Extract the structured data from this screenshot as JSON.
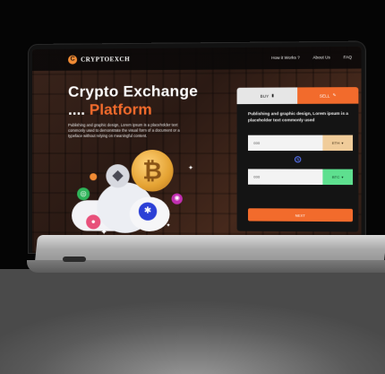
{
  "nav": {
    "logo_mark": "C",
    "brand": "CRYPTOEXCH",
    "links": [
      "How it Works ?",
      "About Us",
      "FAQ"
    ]
  },
  "hero": {
    "title_line1": "Crypto Exchange",
    "title_dots": "....",
    "title_accent": "Platform",
    "description": "Publishing and graphic design, Lorem ipsum is a placeholder text commonly used to demonstrate the visual form of a document or a typeface without relying on meaningful content."
  },
  "illustration": {
    "btc_symbol": "₿",
    "eth_symbol": "◆"
  },
  "exchange": {
    "tab_buy": "BUY",
    "tab_sell": "SELL",
    "title": "Publishing and graphic design, Lorem ipsum is a placeholder text commonly used",
    "field1_value": "000",
    "field1_currency": "ETH",
    "field2_value": "000",
    "field2_currency": "BTC",
    "next_label": "NEXT"
  },
  "colors": {
    "accent": "#f26b2c",
    "buy_tab": "#e6e6e6",
    "panel_bg": "#141414",
    "currency1_bg": "#f0cc9a",
    "currency2_bg": "#5ee08f"
  }
}
